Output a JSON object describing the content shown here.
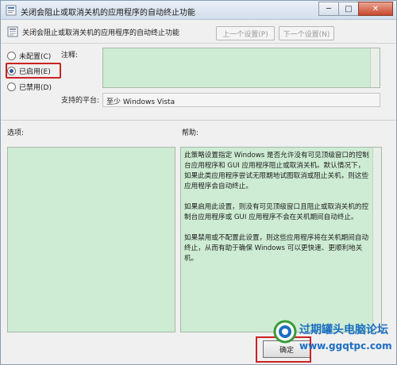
{
  "window": {
    "title": "关闭会阻止或取消关机的应用程序的自动终止功能",
    "close_glyph": "✕",
    "maximize_glyph": "□",
    "minimize_glyph": "─"
  },
  "header": {
    "policy_title": "关闭会阻止或取消关机的应用程序的自动终止功能",
    "prev_button": "上一个设置(P)",
    "next_button": "下一个设置(N)"
  },
  "radio_options": [
    {
      "label": "未配置(C)",
      "checked": false
    },
    {
      "label": "已启用(E)",
      "checked": true
    },
    {
      "label": "已禁用(D)",
      "checked": false
    }
  ],
  "comment": {
    "label": "注释:",
    "value": ""
  },
  "platform": {
    "label": "支持的平台:",
    "value": "至少 Windows Vista"
  },
  "options": {
    "label": "选项:"
  },
  "help": {
    "label": "帮助:",
    "paragraphs": [
      "此策略设置指定 Windows 是否允许没有可见顶级窗口的控制台应用程序和 GUI 应用程序阻止或取消关机。默认情况下，如果此类应用程序尝试无限期地试图取消或阻止关机，则这些应用程序会自动终止。",
      "如果启用此设置，则没有可见顶级窗口且阻止或取消关机的控制台应用程序或 GUI 应用程序不会在关机期间自动终止。",
      "如果禁用或不配置此设置，则这些应用程序将在关机期间自动终止，从而有助于确保 Windows 可以更快速、更顺利地关机。"
    ]
  },
  "footer": {
    "ok_button": "确定"
  },
  "watermark": {
    "title": "过期罐头电脑论坛",
    "url": "www.ggqtpc.com"
  },
  "colors": {
    "highlight": "#cc2222",
    "pane_green": "#cdecd3",
    "watermark_blue": "#1c6ec2"
  }
}
